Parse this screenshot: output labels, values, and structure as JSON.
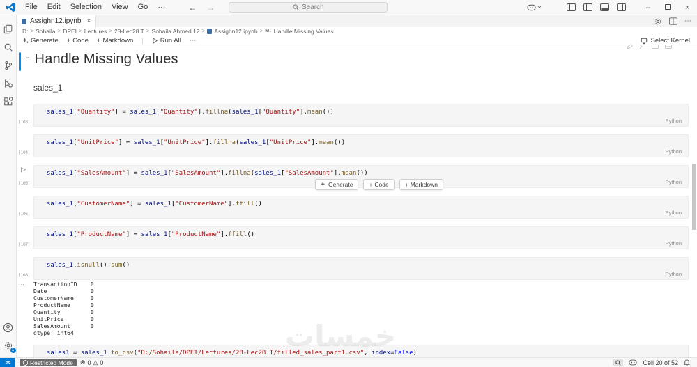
{
  "titlebar": {
    "menus": [
      "File",
      "Edit",
      "Selection",
      "View",
      "Go",
      "⋯"
    ],
    "nav_back": "←",
    "nav_forward": "→",
    "search_placeholder": "Search",
    "controls": {
      "minimize": "–",
      "close": "×"
    }
  },
  "tabbar": {
    "tab_label": "Assighn12.ipynb",
    "tab_close": "×",
    "more_actions": "⋯"
  },
  "breadcrumbs": {
    "separator": ">",
    "items": [
      {
        "label": "D:"
      },
      {
        "label": "Sohaila"
      },
      {
        "label": "DPEI"
      },
      {
        "label": "Lectures"
      },
      {
        "label": "28-Lec28 T"
      },
      {
        "label": "Sohaila Ahmed 12"
      },
      {
        "label": "Assighn12.ipynb",
        "icon": "notebook"
      },
      {
        "label": "Handle Missing Values",
        "icon": "markdown"
      }
    ]
  },
  "toolbar": {
    "generate": "Generate",
    "add_code": "Code",
    "add_markdown": "Markdown",
    "run_all": "Run All",
    "more": "⋯",
    "select_kernel": "Select Kernel"
  },
  "notebook": {
    "heading": "Handle Missing Values",
    "collapse_chevron": "⌄",
    "subtext": "sales_1",
    "insert_toolbar": {
      "generate": "Generate",
      "code": "Code",
      "markdown": "Markdown"
    },
    "cells": [
      {
        "exec": "[103]",
        "run": false,
        "lang": "Python",
        "output": false,
        "tokens": [
          [
            "v",
            "sales_1"
          ],
          [
            "p",
            "["
          ],
          [
            "s",
            "\"Quantity\""
          ],
          [
            "p",
            "] = "
          ],
          [
            "v",
            "sales_1"
          ],
          [
            "p",
            "["
          ],
          [
            "s",
            "\"Quantity\""
          ],
          [
            "p",
            "]."
          ],
          [
            "f",
            "fillna"
          ],
          [
            "p",
            "("
          ],
          [
            "v",
            "sales_1"
          ],
          [
            "p",
            "["
          ],
          [
            "s",
            "\"Quantity\""
          ],
          [
            "p",
            "]."
          ],
          [
            "f",
            "mean"
          ],
          [
            "p",
            "())"
          ]
        ]
      },
      {
        "exec": "[104]",
        "run": false,
        "lang": "Python",
        "output": false,
        "tokens": [
          [
            "v",
            "sales_1"
          ],
          [
            "p",
            "["
          ],
          [
            "s",
            "\"UnitPrice\""
          ],
          [
            "p",
            "] = "
          ],
          [
            "v",
            "sales_1"
          ],
          [
            "p",
            "["
          ],
          [
            "s",
            "\"UnitPrice\""
          ],
          [
            "p",
            "]."
          ],
          [
            "f",
            "fillna"
          ],
          [
            "p",
            "("
          ],
          [
            "v",
            "sales_1"
          ],
          [
            "p",
            "["
          ],
          [
            "s",
            "\"UnitPrice\""
          ],
          [
            "p",
            "]."
          ],
          [
            "f",
            "mean"
          ],
          [
            "p",
            "())"
          ]
        ]
      },
      {
        "exec": "[105]",
        "run": true,
        "lang": "Python",
        "output": false,
        "tokens": [
          [
            "v",
            "sales_1"
          ],
          [
            "p",
            "["
          ],
          [
            "s",
            "\"SalesAmount\""
          ],
          [
            "p",
            "] = "
          ],
          [
            "v",
            "sales_1"
          ],
          [
            "p",
            "["
          ],
          [
            "s",
            "\"SalesAmount\""
          ],
          [
            "p",
            "]."
          ],
          [
            "f",
            "fillna"
          ],
          [
            "p",
            "("
          ],
          [
            "v",
            "sales_1"
          ],
          [
            "p",
            "["
          ],
          [
            "s",
            "\"SalesAmount\""
          ],
          [
            "p",
            "]."
          ],
          [
            "f",
            "mean"
          ],
          [
            "p",
            "())"
          ]
        ]
      },
      {
        "exec": "[106]",
        "run": false,
        "lang": "Python",
        "output": false,
        "tokens": [
          [
            "v",
            "sales_1"
          ],
          [
            "p",
            "["
          ],
          [
            "s",
            "\"CustomerName\""
          ],
          [
            "p",
            "] = "
          ],
          [
            "v",
            "sales_1"
          ],
          [
            "p",
            "["
          ],
          [
            "s",
            "\"CustomerName\""
          ],
          [
            "p",
            "]."
          ],
          [
            "f",
            "ffill"
          ],
          [
            "p",
            "()"
          ]
        ]
      },
      {
        "exec": "[107]",
        "run": false,
        "lang": "Python",
        "output": false,
        "tokens": [
          [
            "v",
            "sales_1"
          ],
          [
            "p",
            "["
          ],
          [
            "s",
            "\"ProductName\""
          ],
          [
            "p",
            "] = "
          ],
          [
            "v",
            "sales_1"
          ],
          [
            "p",
            "["
          ],
          [
            "s",
            "\"ProductName\""
          ],
          [
            "p",
            "]."
          ],
          [
            "f",
            "ffill"
          ],
          [
            "p",
            "()"
          ]
        ]
      },
      {
        "exec": "[108]",
        "run": false,
        "lang": "Python",
        "output": true,
        "tokens": [
          [
            "v",
            "sales_1"
          ],
          [
            "p",
            "."
          ],
          [
            "f",
            "isnull"
          ],
          [
            "p",
            "()."
          ],
          [
            "f",
            "sum"
          ],
          [
            "p",
            "()"
          ]
        ]
      },
      {
        "exec": "",
        "run": false,
        "lang": "Python",
        "output": false,
        "tokens": [
          [
            "v",
            "sales1"
          ],
          [
            "p",
            " = "
          ],
          [
            "v",
            "sales_1"
          ],
          [
            "p",
            "."
          ],
          [
            "f",
            "to_csv"
          ],
          [
            "p",
            "("
          ],
          [
            "s",
            "\"D:/Sohaila/DPEI/Lectures/28-Lec28 T/filled_sales_part1.csv\""
          ],
          [
            "p",
            ", "
          ],
          [
            "v",
            "index"
          ],
          [
            "p",
            "="
          ],
          [
            "k",
            "False"
          ],
          [
            "p",
            ")"
          ]
        ]
      }
    ],
    "output": {
      "gutter": "⋯",
      "lines": [
        "TransactionID    0",
        "Date             0",
        "CustomerName     0",
        "ProductName      0",
        "Quantity         0",
        "UnitPrice        0",
        "SalesAmount      0",
        "dtype: int64"
      ]
    }
  },
  "statusbar": {
    "remote_glyph": "><",
    "restricted_mode": "Restricted Mode",
    "errors": "0",
    "warnings": "0",
    "errors_glyph": "⊗",
    "warnings_glyph": "△",
    "cell_indicator": "Cell 20 of 52"
  },
  "watermark": "خمسات",
  "colors": {
    "accent_blue": "#0078d4",
    "cell_focus": "#0090f1",
    "string": "#a31515",
    "function": "#795e26",
    "variable": "#001080",
    "keyword": "#0000ff"
  }
}
